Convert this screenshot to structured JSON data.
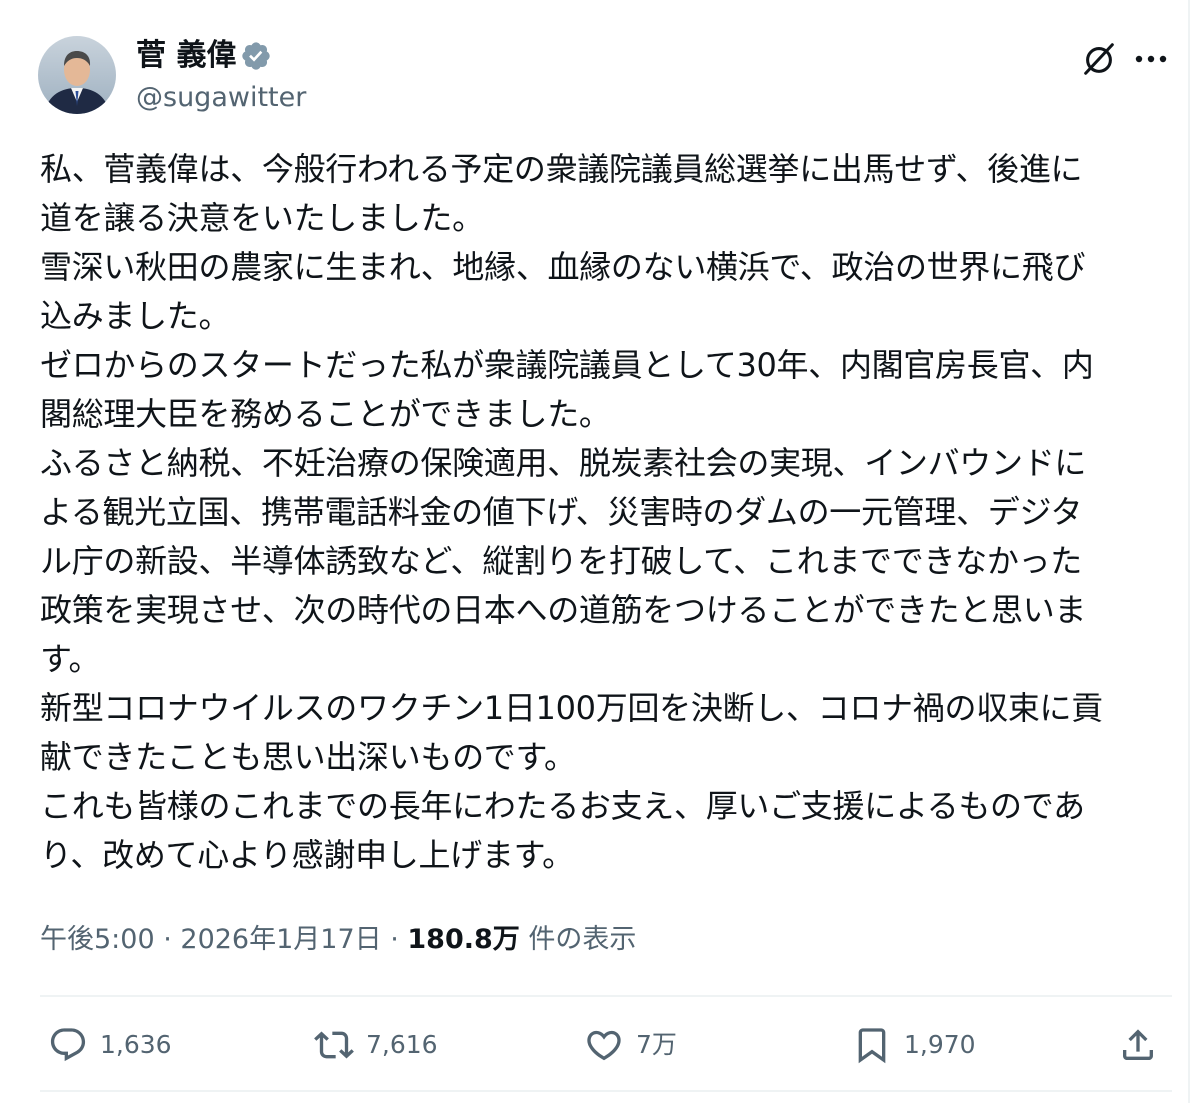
{
  "author": {
    "name": "菅 義偉",
    "handle": "@sugawitter",
    "verified": true
  },
  "header_icons": [
    "grok-icon",
    "more-icon"
  ],
  "tweet": {
    "lines": [
      "私、菅義偉は、今般行われる予定の衆議院議員総選挙に出馬せず、後進に",
      "道を譲る決意をいたしました。",
      "雪深い秋田の農家に生まれ、地縁、血縁のない横浜で、政治の世界に飛び",
      "込みました。",
      "ゼロからのスタートだった私が衆議院議員として30年、内閣官房長官、内",
      "閣総理大臣を務めることができました。",
      "ふるさと納税、不妊治療の保険適用、脱炭素社会の実現、インバウンドに",
      "よる観光立国、携帯電話料金の値下げ、災害時のダムの一元管理、デジタ",
      "ル庁の新設、半導体誘致など、縦割りを打破して、これまでできなかった",
      "政策を実現させ、次の時代の日本への道筋をつけることができたと思いま",
      "す。",
      "新型コロナウイルスのワクチン1日100万回を決断し、コロナ禍の収束に貢",
      "献できたことも思い出深いものです。",
      "これも皆様のこれまでの長年にわたるお支え、厚いご支援によるものであ",
      "り、改めて心より感謝申し上げます。"
    ]
  },
  "meta": {
    "time": "午後5:00",
    "separator": " · ",
    "date": "2026年1月17日",
    "views": "180.8万",
    "views_label": " 件の表示"
  },
  "actions": {
    "replies": "1,636",
    "reposts": "7,616",
    "likes": "7万",
    "bookmarks": "1,970"
  },
  "colors": {
    "text": "#0f1419",
    "secondary": "#536471",
    "divider": "#eff3f4",
    "verified_badge": "#829aab"
  }
}
